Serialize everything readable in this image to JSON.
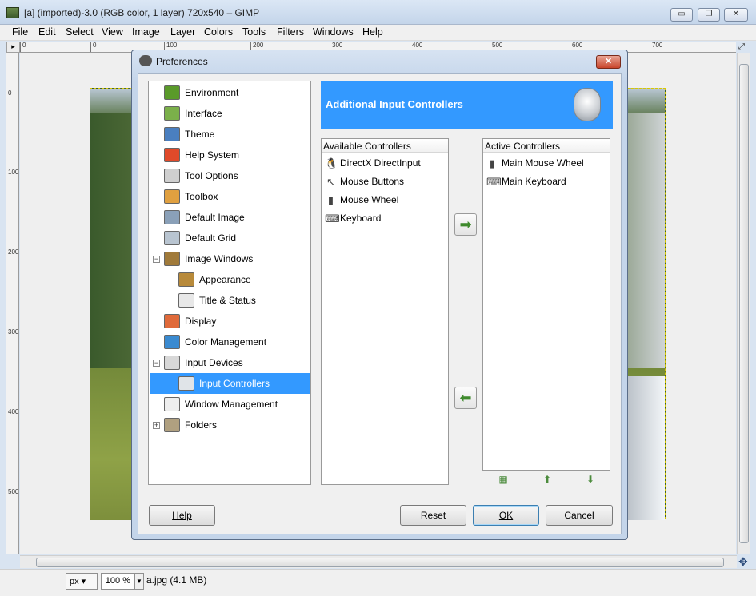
{
  "window": {
    "title": "[a] (imported)-3.0 (RGB color, 1 layer) 720x540 – GIMP",
    "minimize": "▭",
    "maximize": "❐",
    "close": "✕"
  },
  "menu": [
    "File",
    "Edit",
    "Select",
    "View",
    "Image",
    "Layer",
    "Colors",
    "Tools",
    "Filters",
    "Windows",
    "Help"
  ],
  "ruler_top": [
    "0",
    "0",
    "100",
    "200",
    "300",
    "400",
    "500",
    "600",
    "700"
  ],
  "ruler_left": [
    "0",
    "100",
    "200",
    "300",
    "400",
    "500"
  ],
  "statusbar": {
    "unit": "px",
    "zoom": "100 %",
    "status": "a.jpg (4.1 MB)"
  },
  "dialog": {
    "title": "Preferences",
    "close": "✕",
    "tree": [
      {
        "label": "Environment",
        "color": "#5a9a2a",
        "indent": 0
      },
      {
        "label": "Interface",
        "color": "#7bb04a",
        "indent": 0
      },
      {
        "label": "Theme",
        "color": "#4a7fc0",
        "indent": 0
      },
      {
        "label": "Help System",
        "color": "#e04a2a",
        "indent": 0
      },
      {
        "label": "Tool Options",
        "color": "#cfcfcf",
        "indent": 0
      },
      {
        "label": "Toolbox",
        "color": "#e0a040",
        "indent": 0
      },
      {
        "label": "Default Image",
        "color": "#8aa0b8",
        "indent": 0
      },
      {
        "label": "Default Grid",
        "color": "#b8c4d0",
        "indent": 0
      },
      {
        "label": "Image Windows",
        "color": "#a07a3a",
        "indent": 0,
        "expander": "−"
      },
      {
        "label": "Appearance",
        "color": "#b88a3a",
        "indent": 1
      },
      {
        "label": "Title & Status",
        "color": "#e8e8e8",
        "indent": 1
      },
      {
        "label": "Display",
        "color": "#e06a3a",
        "indent": 0
      },
      {
        "label": "Color Management",
        "color": "#3a8ad0",
        "indent": 0
      },
      {
        "label": "Input Devices",
        "color": "#d8d8d8",
        "indent": 0,
        "expander": "−"
      },
      {
        "label": "Input Controllers",
        "color": "#e0e4e8",
        "indent": 1,
        "selected": true
      },
      {
        "label": "Window Management",
        "color": "#eeeeee",
        "indent": 0
      },
      {
        "label": "Folders",
        "color": "#b0a080",
        "indent": 0,
        "expander": "+"
      }
    ],
    "header": "Additional Input Controllers",
    "available": {
      "heading": "Available Controllers",
      "items": [
        {
          "label": "DirectX DirectInput",
          "icon": "🐧"
        },
        {
          "label": "Mouse Buttons",
          "icon": "↖"
        },
        {
          "label": "Mouse Wheel",
          "icon": "▮"
        },
        {
          "label": "Keyboard",
          "icon": "⌨"
        }
      ]
    },
    "active": {
      "heading": "Active Controllers",
      "items": [
        {
          "label": "Main Mouse Wheel",
          "icon": "▮"
        },
        {
          "label": "Main Keyboard",
          "icon": "⌨"
        }
      ]
    },
    "add_arrow": "➡",
    "remove_arrow": "⬅",
    "tools": [
      "▦",
      "⬆",
      "⬇"
    ],
    "buttons": {
      "help": "Help",
      "reset": "Reset",
      "ok": "OK",
      "cancel": "Cancel"
    }
  }
}
